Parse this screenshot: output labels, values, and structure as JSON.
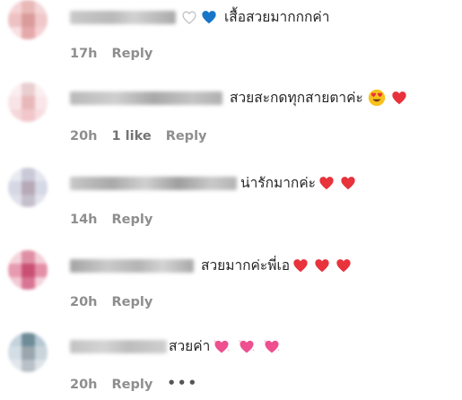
{
  "comments": [
    {
      "text": "เสื้อสวยมากกกค่า",
      "emoji_prefix": [
        "white-heart",
        "blue-heart"
      ],
      "emoji": [],
      "time": "17h",
      "likes": "",
      "reply": "Reply",
      "more": ""
    },
    {
      "text": "สวยสะกดทุกสายตาค่ะ",
      "emoji_prefix": [],
      "emoji": [
        "heart-eyes",
        "red-heart"
      ],
      "time": "20h",
      "likes": "1 like",
      "reply": "Reply",
      "more": ""
    },
    {
      "text": "น่ารักมากค่ะ",
      "emoji_prefix": [],
      "emoji": [
        "red-heart",
        "red-heart"
      ],
      "time": "14h",
      "likes": "",
      "reply": "Reply",
      "more": ""
    },
    {
      "text": "สวยมากค่ะพี่เอ",
      "emoji_prefix": [],
      "emoji": [
        "red-heart",
        "red-heart",
        "red-heart"
      ],
      "time": "20h",
      "likes": "",
      "reply": "Reply",
      "more": ""
    },
    {
      "text": "สวยค่า",
      "emoji_prefix": [],
      "emoji": [
        "sparkling-heart",
        "sparkling-heart",
        "sparkling-heart"
      ],
      "time": "20h",
      "likes": "",
      "reply": "Reply",
      "more": "•••"
    }
  ],
  "colors": {
    "text": "#262626",
    "meta": "#8e8e8e",
    "red_heart": "#e8323c",
    "blue_heart": "#1875c7",
    "pink_heart": "#ee4f8f"
  }
}
